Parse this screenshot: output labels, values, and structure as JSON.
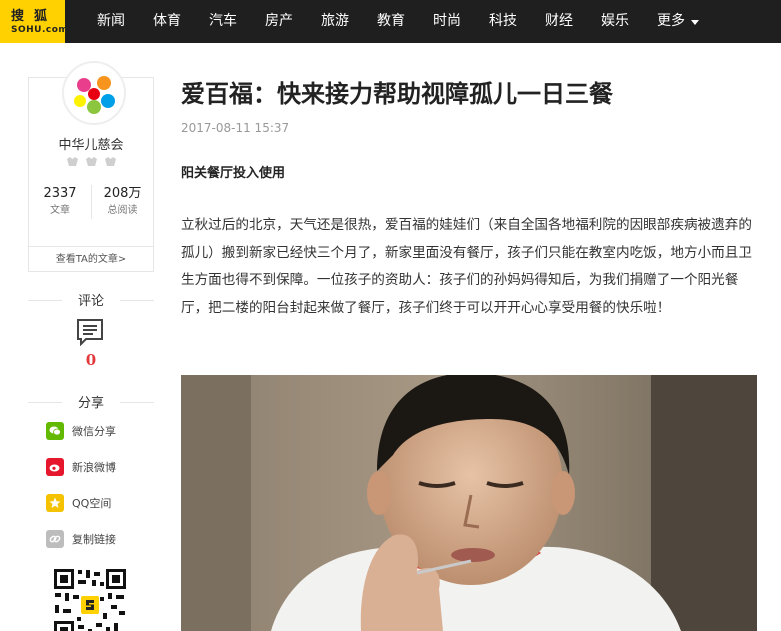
{
  "header": {
    "logo_cn": "搜狐",
    "logo_en": "SOHU.com",
    "nav": [
      "新闻",
      "体育",
      "汽车",
      "房产",
      "旅游",
      "教育",
      "时尚",
      "科技",
      "财经",
      "娱乐"
    ],
    "more_label": "更多",
    "colors": {
      "bar": "#1f1f1f",
      "logo": "#ffd100"
    }
  },
  "author": {
    "name": "中华儿慈会",
    "articles_count": "2337",
    "articles_label": "文章",
    "views_count": "208万",
    "views_label": "总阅读",
    "view_articles_label": "查看TA的文章>"
  },
  "comments": {
    "title": "评论",
    "count": "0",
    "icon": "comment-icon"
  },
  "share": {
    "title": "分享",
    "items": [
      {
        "label": "微信分享",
        "icon": "wechat-icon",
        "color": "#62b900"
      },
      {
        "label": "新浪微博",
        "icon": "weibo-icon",
        "color": "#e6162d"
      },
      {
        "label": "QQ空间",
        "icon": "qzone-icon",
        "color": "#f5c200"
      },
      {
        "label": "复制链接",
        "icon": "link-icon",
        "color": "#bdbdbd"
      }
    ]
  },
  "article": {
    "title": "爱百福：快来接力帮助视障孤儿一日三餐",
    "date": "2017-08-11 15:37",
    "subhead": "阳关餐厅投入使用",
    "paragraph": "立秋过后的北京，天气还是很热，爱百福的娃娃们（来自全国各地福利院的因眼部疾病被遗弃的孤儿）搬到新家已经快三个月了，新家里面没有餐厅，孩子们只能在教室内吃饭，地方小而且卫生方面也得不到保障。一位孩子的资助人：孩子们的孙妈妈得知后，为我们捐赠了一个阳光餐厅，把二楼的阳台封起来做了餐厅，孩子们终于可以开开心心享受用餐的快乐啦！"
  }
}
